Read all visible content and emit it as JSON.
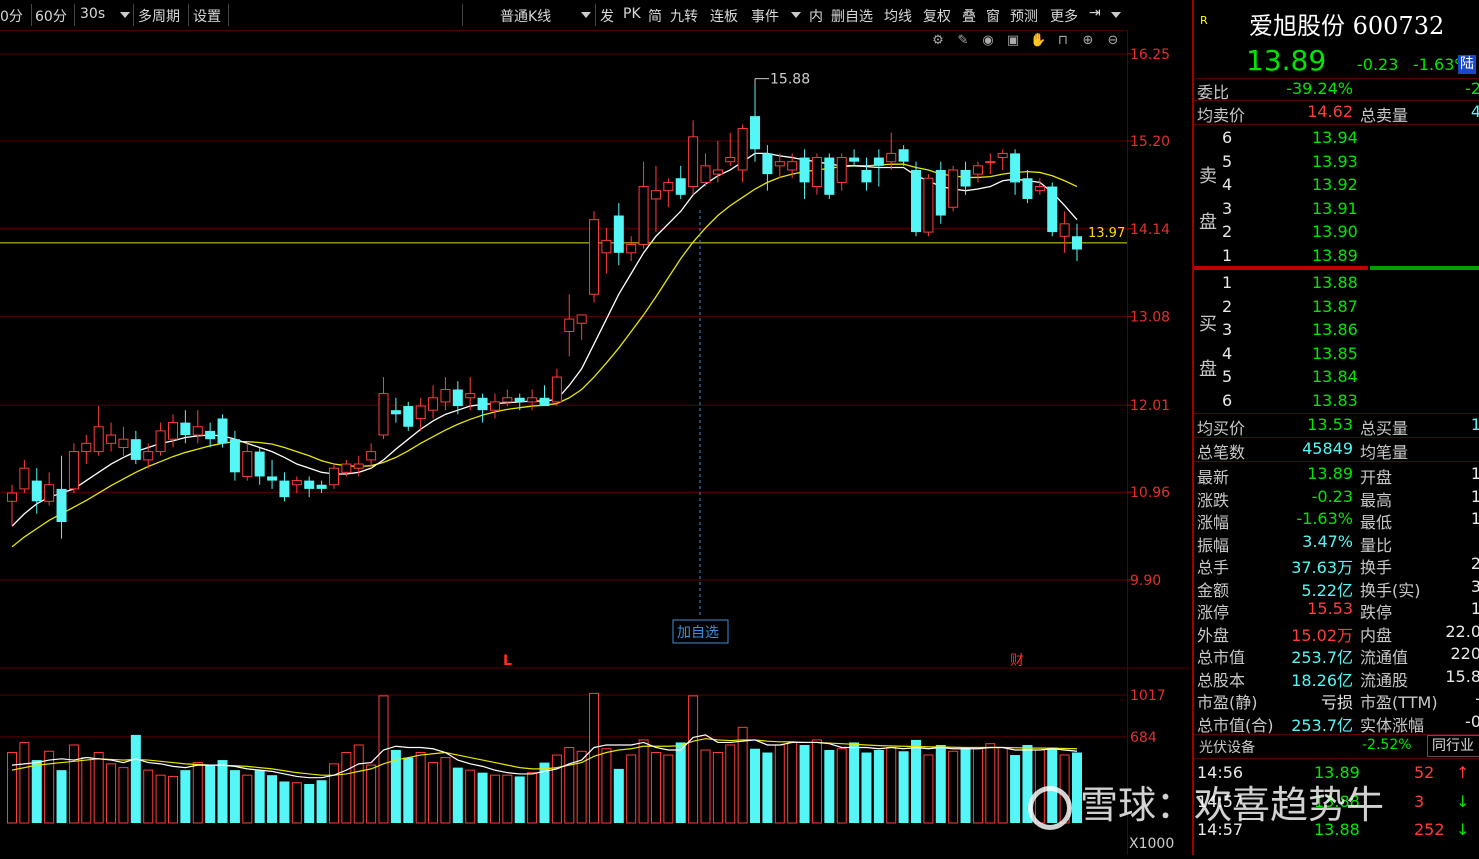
{
  "toolbar": {
    "items": [
      "0分",
      "60分",
      "30s",
      "多周期",
      "设置",
      "普通K线",
      "发",
      "PK",
      "简",
      "九转",
      "连板",
      "事件",
      "内",
      "删自选",
      "均线",
      "复权",
      "叠",
      "窗",
      "预测",
      "更多"
    ]
  },
  "chart": {
    "price_ticks": [
      "16.25",
      "15.20",
      "14.14",
      "13.08",
      "12.01",
      "10.96",
      "9.90"
    ],
    "volume_ticks": [
      "1017",
      "684"
    ],
    "volume_unit": "X1000",
    "high_label": "15.88",
    "hline_label": "13.97",
    "add_watch_label": "加自选",
    "marker_l": "L",
    "marker_cai": "财"
  },
  "chart_data": {
    "type": "candlestick",
    "price_range": [
      9.6,
      16.5
    ],
    "volume_range": [
      0,
      1200
    ],
    "reference_line": 13.97,
    "candles": [
      {
        "o": 10.85,
        "h": 11.05,
        "l": 10.55,
        "c": 10.95
      },
      {
        "o": 11.0,
        "h": 11.35,
        "l": 10.95,
        "c": 11.25
      },
      {
        "o": 11.1,
        "h": 11.25,
        "l": 10.7,
        "c": 10.85
      },
      {
        "o": 10.85,
        "h": 11.2,
        "l": 10.8,
        "c": 11.05
      },
      {
        "o": 11.0,
        "h": 11.4,
        "l": 10.4,
        "c": 10.6
      },
      {
        "o": 11.0,
        "h": 11.55,
        "l": 10.95,
        "c": 11.45
      },
      {
        "o": 11.45,
        "h": 11.65,
        "l": 11.3,
        "c": 11.55
      },
      {
        "o": 11.45,
        "h": 12.0,
        "l": 11.4,
        "c": 11.75
      },
      {
        "o": 11.55,
        "h": 11.8,
        "l": 11.45,
        "c": 11.65
      },
      {
        "o": 11.5,
        "h": 11.75,
        "l": 11.4,
        "c": 11.6
      },
      {
        "o": 11.6,
        "h": 11.7,
        "l": 11.3,
        "c": 11.35
      },
      {
        "o": 11.35,
        "h": 11.55,
        "l": 11.25,
        "c": 11.45
      },
      {
        "o": 11.45,
        "h": 11.8,
        "l": 11.4,
        "c": 11.7
      },
      {
        "o": 11.6,
        "h": 11.9,
        "l": 11.5,
        "c": 11.8
      },
      {
        "o": 11.8,
        "h": 11.95,
        "l": 11.55,
        "c": 11.65
      },
      {
        "o": 11.65,
        "h": 11.95,
        "l": 11.55,
        "c": 11.75
      },
      {
        "o": 11.7,
        "h": 11.8,
        "l": 11.5,
        "c": 11.6
      },
      {
        "o": 11.85,
        "h": 11.9,
        "l": 11.5,
        "c": 11.55
      },
      {
        "o": 11.6,
        "h": 11.7,
        "l": 11.1,
        "c": 11.2
      },
      {
        "o": 11.15,
        "h": 11.55,
        "l": 11.1,
        "c": 11.45
      },
      {
        "o": 11.45,
        "h": 11.5,
        "l": 11.05,
        "c": 11.15
      },
      {
        "o": 11.15,
        "h": 11.35,
        "l": 11.0,
        "c": 11.1
      },
      {
        "o": 11.1,
        "h": 11.2,
        "l": 10.85,
        "c": 10.9
      },
      {
        "o": 11.05,
        "h": 11.15,
        "l": 10.95,
        "c": 11.1
      },
      {
        "o": 11.1,
        "h": 11.15,
        "l": 10.9,
        "c": 11.0
      },
      {
        "o": 11.05,
        "h": 11.1,
        "l": 10.95,
        "c": 11.0
      },
      {
        "o": 11.05,
        "h": 11.3,
        "l": 11.0,
        "c": 11.25
      },
      {
        "o": 11.2,
        "h": 11.35,
        "l": 11.15,
        "c": 11.3
      },
      {
        "o": 11.25,
        "h": 11.4,
        "l": 11.15,
        "c": 11.3
      },
      {
        "o": 11.35,
        "h": 11.55,
        "l": 11.25,
        "c": 11.45
      },
      {
        "o": 11.65,
        "h": 12.35,
        "l": 11.6,
        "c": 12.15
      },
      {
        "o": 11.95,
        "h": 12.1,
        "l": 11.8,
        "c": 11.9
      },
      {
        "o": 12.0,
        "h": 12.05,
        "l": 11.7,
        "c": 11.75
      },
      {
        "o": 11.85,
        "h": 12.1,
        "l": 11.7,
        "c": 12.0
      },
      {
        "o": 11.95,
        "h": 12.25,
        "l": 11.85,
        "c": 12.1
      },
      {
        "o": 12.05,
        "h": 12.35,
        "l": 11.95,
        "c": 12.2
      },
      {
        "o": 12.2,
        "h": 12.3,
        "l": 11.9,
        "c": 12.0
      },
      {
        "o": 12.1,
        "h": 12.35,
        "l": 11.95,
        "c": 12.15
      },
      {
        "o": 12.1,
        "h": 12.15,
        "l": 11.8,
        "c": 11.95
      },
      {
        "o": 11.95,
        "h": 12.15,
        "l": 11.85,
        "c": 12.05
      },
      {
        "o": 12.05,
        "h": 12.2,
        "l": 12.0,
        "c": 12.1
      },
      {
        "o": 12.1,
        "h": 12.15,
        "l": 11.95,
        "c": 12.05
      },
      {
        "o": 12.05,
        "h": 12.2,
        "l": 11.95,
        "c": 12.1
      },
      {
        "o": 12.1,
        "h": 12.25,
        "l": 12.0,
        "c": 12.0
      },
      {
        "o": 12.05,
        "h": 12.45,
        "l": 12.0,
        "c": 12.35
      },
      {
        "o": 12.9,
        "h": 13.35,
        "l": 12.6,
        "c": 13.05
      },
      {
        "o": 13.0,
        "h": 13.1,
        "l": 12.8,
        "c": 13.1
      },
      {
        "o": 13.35,
        "h": 14.35,
        "l": 13.25,
        "c": 14.25
      },
      {
        "o": 13.85,
        "h": 14.15,
        "l": 13.6,
        "c": 14.0
      },
      {
        "o": 14.3,
        "h": 14.45,
        "l": 13.7,
        "c": 13.85
      },
      {
        "o": 13.85,
        "h": 14.05,
        "l": 13.75,
        "c": 13.95
      },
      {
        "o": 13.95,
        "h": 14.95,
        "l": 13.9,
        "c": 14.65
      },
      {
        "o": 14.5,
        "h": 14.9,
        "l": 14.1,
        "c": 14.6
      },
      {
        "o": 14.6,
        "h": 14.75,
        "l": 14.4,
        "c": 14.7
      },
      {
        "o": 14.75,
        "h": 14.9,
        "l": 14.5,
        "c": 14.55
      },
      {
        "o": 14.65,
        "h": 15.45,
        "l": 14.55,
        "c": 15.25
      },
      {
        "o": 14.7,
        "h": 15.05,
        "l": 14.65,
        "c": 14.9
      },
      {
        "o": 14.8,
        "h": 15.2,
        "l": 14.7,
        "c": 14.85
      },
      {
        "o": 14.95,
        "h": 15.3,
        "l": 14.9,
        "c": 15.0
      },
      {
        "o": 14.85,
        "h": 15.4,
        "l": 14.7,
        "c": 15.35
      },
      {
        "o": 15.5,
        "h": 15.88,
        "l": 14.95,
        "c": 15.1
      },
      {
        "o": 15.05,
        "h": 15.15,
        "l": 14.6,
        "c": 14.8
      },
      {
        "o": 14.9,
        "h": 15.05,
        "l": 14.75,
        "c": 14.95
      },
      {
        "o": 14.85,
        "h": 15.05,
        "l": 14.75,
        "c": 14.95
      },
      {
        "o": 15.0,
        "h": 15.1,
        "l": 14.5,
        "c": 14.7
      },
      {
        "o": 14.65,
        "h": 15.05,
        "l": 14.55,
        "c": 15.0
      },
      {
        "o": 15.0,
        "h": 15.05,
        "l": 14.5,
        "c": 14.55
      },
      {
        "o": 14.7,
        "h": 15.05,
        "l": 14.6,
        "c": 15.0
      },
      {
        "o": 15.0,
        "h": 15.1,
        "l": 14.9,
        "c": 14.95
      },
      {
        "o": 14.85,
        "h": 15.0,
        "l": 14.6,
        "c": 14.7
      },
      {
        "o": 15.0,
        "h": 15.1,
        "l": 14.65,
        "c": 14.9
      },
      {
        "o": 14.95,
        "h": 15.3,
        "l": 14.85,
        "c": 15.05
      },
      {
        "o": 15.1,
        "h": 15.15,
        "l": 14.9,
        "c": 14.95
      },
      {
        "o": 14.85,
        "h": 14.95,
        "l": 14.05,
        "c": 14.1
      },
      {
        "o": 14.1,
        "h": 14.8,
        "l": 14.05,
        "c": 14.75
      },
      {
        "o": 14.85,
        "h": 14.95,
        "l": 14.2,
        "c": 14.3
      },
      {
        "o": 14.4,
        "h": 14.9,
        "l": 14.35,
        "c": 14.85
      },
      {
        "o": 14.85,
        "h": 14.95,
        "l": 14.55,
        "c": 14.65
      },
      {
        "o": 14.8,
        "h": 14.95,
        "l": 14.7,
        "c": 14.9
      },
      {
        "o": 14.95,
        "h": 15.05,
        "l": 14.8,
        "c": 14.95
      },
      {
        "o": 15.0,
        "h": 15.1,
        "l": 14.85,
        "c": 15.05
      },
      {
        "o": 15.05,
        "h": 15.1,
        "l": 14.55,
        "c": 14.7
      },
      {
        "o": 14.75,
        "h": 14.85,
        "l": 14.45,
        "c": 14.5
      },
      {
        "o": 14.6,
        "h": 14.75,
        "l": 14.55,
        "c": 14.65
      },
      {
        "o": 14.65,
        "h": 14.7,
        "l": 14.05,
        "c": 14.1
      },
      {
        "o": 14.05,
        "h": 14.35,
        "l": 13.85,
        "c": 14.2
      },
      {
        "o": 14.05,
        "h": 14.2,
        "l": 13.75,
        "c": 13.89
      }
    ],
    "ma_white": [
      10.55,
      10.7,
      10.82,
      10.9,
      10.95,
      11.0,
      11.1,
      11.2,
      11.3,
      11.38,
      11.45,
      11.5,
      11.55,
      11.58,
      11.62,
      11.64,
      11.65,
      11.64,
      11.6,
      11.55,
      11.5,
      11.45,
      11.38,
      11.3,
      11.25,
      11.2,
      11.18,
      11.18,
      11.2,
      11.25,
      11.35,
      11.48,
      11.6,
      11.72,
      11.82,
      11.9,
      11.95,
      12.0,
      12.02,
      12.03,
      12.04,
      12.05,
      12.06,
      12.06,
      12.08,
      12.25,
      12.45,
      12.75,
      13.05,
      13.35,
      13.6,
      13.85,
      14.05,
      14.2,
      14.35,
      14.55,
      14.68,
      14.78,
      14.85,
      14.95,
      15.05,
      15.05,
      15.02,
      15.0,
      14.97,
      14.95,
      14.92,
      14.9,
      14.9,
      14.89,
      14.88,
      14.88,
      14.88,
      14.78,
      14.72,
      14.65,
      14.62,
      14.6,
      14.62,
      14.65,
      14.72,
      14.74,
      14.72,
      14.7,
      14.58,
      14.42,
      14.25
    ],
    "ma_yellow": [
      10.3,
      10.42,
      10.52,
      10.62,
      10.7,
      10.78,
      10.86,
      10.95,
      11.04,
      11.12,
      11.2,
      11.27,
      11.33,
      11.39,
      11.44,
      11.48,
      11.52,
      11.55,
      11.57,
      11.57,
      11.56,
      11.54,
      11.5,
      11.45,
      11.4,
      11.34,
      11.3,
      11.28,
      11.27,
      11.28,
      11.32,
      11.38,
      11.46,
      11.55,
      11.63,
      11.71,
      11.78,
      11.84,
      11.89,
      11.93,
      11.96,
      11.98,
      12.0,
      12.01,
      12.03,
      12.1,
      12.2,
      12.35,
      12.52,
      12.7,
      12.9,
      13.1,
      13.32,
      13.55,
      13.78,
      13.98,
      14.15,
      14.3,
      14.42,
      14.52,
      14.62,
      14.7,
      14.76,
      14.8,
      14.83,
      14.85,
      14.87,
      14.89,
      14.9,
      14.9,
      14.91,
      14.92,
      14.92,
      14.88,
      14.85,
      14.8,
      14.78,
      14.76,
      14.76,
      14.77,
      14.8,
      14.82,
      14.83,
      14.82,
      14.78,
      14.72,
      14.65
    ],
    "volume": [
      560,
      640,
      500,
      570,
      420,
      620,
      520,
      560,
      470,
      440,
      700,
      420,
      380,
      370,
      420,
      480,
      460,
      500,
      420,
      380,
      420,
      380,
      330,
      320,
      310,
      340,
      470,
      560,
      620,
      460,
      1010,
      580,
      520,
      560,
      480,
      520,
      440,
      420,
      400,
      380,
      380,
      370,
      400,
      480,
      540,
      600,
      570,
      1030,
      590,
      430,
      540,
      660,
      560,
      540,
      640,
      1010,
      580,
      560,
      620,
      760,
      590,
      560,
      620,
      640,
      620,
      660,
      580,
      590,
      640,
      560,
      580,
      600,
      570,
      660,
      540,
      620,
      570,
      600,
      590,
      630,
      600,
      540,
      620,
      580,
      600,
      540,
      560
    ],
    "volume_ma_white": [
      460,
      470,
      480,
      500,
      510,
      500,
      520,
      510,
      500,
      480,
      510,
      480,
      470,
      450,
      440,
      460,
      460,
      460,
      450,
      430,
      420,
      410,
      390,
      370,
      360,
      360,
      380,
      420,
      470,
      480,
      580,
      610,
      600,
      600,
      590,
      560,
      500,
      470,
      450,
      420,
      400,
      390,
      390,
      410,
      430,
      470,
      500,
      600,
      620,
      620,
      620,
      640,
      600,
      580,
      580,
      680,
      700,
      640,
      640,
      650,
      660,
      620,
      620,
      640,
      640,
      640,
      630,
      600,
      600,
      600,
      590,
      600,
      590,
      600,
      590,
      600,
      590,
      590,
      590,
      600,
      600,
      580,
      580,
      580,
      590,
      580,
      570
    ],
    "volume_ma_yellow": [
      420,
      440,
      460,
      470,
      480,
      490,
      500,
      510,
      505,
      500,
      505,
      500,
      490,
      480,
      470,
      465,
      460,
      458,
      455,
      450,
      440,
      430,
      415,
      400,
      390,
      380,
      380,
      390,
      410,
      430,
      470,
      500,
      520,
      540,
      550,
      560,
      540,
      520,
      500,
      480,
      460,
      440,
      430,
      430,
      440,
      460,
      480,
      530,
      560,
      580,
      590,
      610,
      610,
      610,
      615,
      650,
      670,
      660,
      655,
      660,
      660,
      650,
      645,
      645,
      640,
      640,
      635,
      630,
      625,
      620,
      615,
      612,
      610,
      608,
      605,
      604,
      602,
      600,
      600,
      600,
      600,
      598,
      596,
      595,
      594,
      592,
      590
    ]
  },
  "quote": {
    "badge": "R",
    "name": "爱旭股份 600732",
    "price": "13.89",
    "change": "-0.23",
    "pct": "-1.63%",
    "market_tag": "陆",
    "weibi_label": "委比",
    "weibi_val": "-39.24%",
    "weibi_val2": "-2",
    "avg_sell_label": "均卖价",
    "avg_sell_val": "14.62",
    "total_sell_label": "总卖量",
    "total_sell_val": "4",
    "sell_side_label_1": "卖",
    "sell_side_label_2": "盘",
    "asks": [
      {
        "level": "6",
        "price": "13.94"
      },
      {
        "level": "5",
        "price": "13.93"
      },
      {
        "level": "4",
        "price": "13.92"
      },
      {
        "level": "3",
        "price": "13.91"
      },
      {
        "level": "2",
        "price": "13.90"
      },
      {
        "level": "1",
        "price": "13.89"
      }
    ],
    "buy_side_label_1": "买",
    "buy_side_label_2": "盘",
    "bids": [
      {
        "level": "1",
        "price": "13.88"
      },
      {
        "level": "2",
        "price": "13.87"
      },
      {
        "level": "3",
        "price": "13.86"
      },
      {
        "level": "4",
        "price": "13.85"
      },
      {
        "level": "5",
        "price": "13.84"
      },
      {
        "level": "6",
        "price": "13.83"
      }
    ],
    "avg_buy_label": "均买价",
    "avg_buy_val": "13.53",
    "total_buy_label": "总买量",
    "total_buy_val": "1",
    "total_trades_label": "总笔数",
    "total_trades_val": "45849",
    "avg_vol_label": "均笔量",
    "stats": [
      {
        "l1": "最新",
        "v1": "13.89",
        "c1": "green",
        "l2": "开盘",
        "v2": "1"
      },
      {
        "l1": "涨跌",
        "v1": "-0.23",
        "c1": "green",
        "l2": "最高",
        "v2": "1"
      },
      {
        "l1": "涨幅",
        "v1": "-1.63%",
        "c1": "green",
        "l2": "最低",
        "v2": "1"
      },
      {
        "l1": "振幅",
        "v1": "3.47%",
        "c1": "cyan",
        "l2": "量比",
        "v2": ""
      },
      {
        "l1": "总手",
        "v1": "37.63万",
        "c1": "cyan",
        "l2": "换手",
        "v2": "2"
      },
      {
        "l1": "金额",
        "v1": "5.22亿",
        "c1": "cyan",
        "l2": "换手(实)",
        "v2": "3"
      },
      {
        "l1": "涨停",
        "v1": "15.53",
        "c1": "red",
        "l2": "跌停",
        "v2": "1"
      },
      {
        "l1": "外盘",
        "v1": "15.02万",
        "c1": "red",
        "l2": "内盘",
        "v2": "22.0"
      },
      {
        "l1": "总市值",
        "v1": "253.7亿",
        "c1": "cyan",
        "l2": "流通值",
        "v2": "220"
      },
      {
        "l1": "总股本",
        "v1": "18.26亿",
        "c1": "cyan",
        "l2": "流通股",
        "v2": "15.8"
      },
      {
        "l1": "市盈(静)",
        "v1": "亏损",
        "c1": "white",
        "l2": "市盈(TTM)",
        "v2": "-"
      },
      {
        "l1": "总市值(合)",
        "v1": "253.7亿",
        "c1": "cyan",
        "l2": "实体涨幅",
        "v2": "-0"
      }
    ],
    "industry": "光伏设备",
    "industry_pct": "-2.52%",
    "industry_btn": "同行业",
    "ticks": [
      {
        "time": "14:56",
        "price": "13.89",
        "vol": "52",
        "dir": "up"
      },
      {
        "time": "14:57",
        "price": "13.88",
        "vol": "3",
        "dir": "down"
      },
      {
        "time": "14:57",
        "price": "13.88",
        "vol": "252",
        "dir": "down"
      }
    ]
  },
  "watermark": "雪球：欢喜趋势牛",
  "colors": {
    "up": "#ff3c3c",
    "down": "#54f7f5",
    "ma_white": "#ffffff",
    "ma_yellow": "#e6e600",
    "ref_line": "#e0e000",
    "grid": "#5a0000"
  }
}
